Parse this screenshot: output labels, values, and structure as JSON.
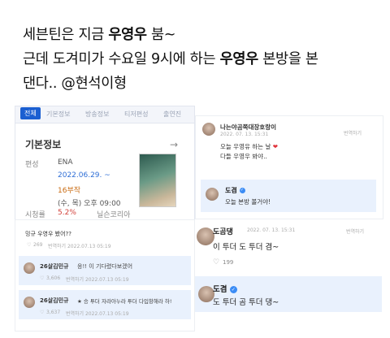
{
  "tweet": {
    "line1_pre": "세븐틴은 지금 ",
    "line1_bold": "우영우",
    "line1_post": " 붐~",
    "line2_pre": "근데 도겨미가 수요일 9시에 하는 ",
    "line2_bold": "우영우",
    "line2_post": " 본방을 본",
    "line3": "댄다.. @현석이형"
  },
  "left_panel": {
    "tabs": [
      "전체",
      "기본정보",
      "방송정보",
      "티저편성",
      "출연진"
    ],
    "section_title": "기본정보",
    "rows": [
      {
        "label": "편성",
        "value": "ENA"
      },
      {
        "label": "",
        "value": "2022.06.29. ~"
      },
      {
        "label": "",
        "value": "16부작"
      },
      {
        "label": "",
        "value": "(수, 목) 오후 09:00"
      },
      {
        "label": "시청률",
        "value": "5.2%",
        "extra": "닐슨코리아"
      }
    ],
    "arrow": "→"
  },
  "left_comments": {
    "top_text": "밍규 우영우 봤어??",
    "top_likes": "269",
    "top_meta": "번역하기  2022.07.13 05:19",
    "c1_name": "26살김민규",
    "c1_text": "응!! 이 기다렸다보겠어",
    "c1_likes": "3,606",
    "c1_meta": "번역하기  2022.07.13 05:19",
    "c2_name": "26살김민규",
    "c2_text": "★ 승 투더 자라아누라 투더 다입항해라 하!",
    "c2_likes": "3,637",
    "c2_meta": "번역하기  2022.07.13 05:19"
  },
  "right_top": {
    "name": "나는야곰쪽대장호랑이",
    "date": "2022. 07. 13. 15:31",
    "translate": "번역하기",
    "line1": "오늘 우영유 하는 날",
    "heart": "❤",
    "line2": "다들 우영우 봐야..",
    "reply_name": "도겸",
    "reply_text": "오늘 본방 볼거야!"
  },
  "right_bottom": {
    "name": "도곰댕",
    "date": "2022. 07. 13. 15:31",
    "translate": "번역하기",
    "text": "이 투더 도 투더 겸~",
    "likes": "199",
    "reply_name": "도겸",
    "reply_text": "도 투더 곰 투더 댕~"
  }
}
